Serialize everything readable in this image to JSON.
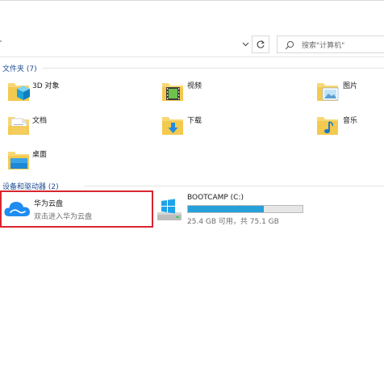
{
  "search": {
    "placeholder": "搜索\"计算机\""
  },
  "folders_section": {
    "title": "文件夹 (7)",
    "items": [
      {
        "name": "3D 对象",
        "icon": "3d-objects-folder-icon"
      },
      {
        "name": "视频",
        "icon": "videos-folder-icon"
      },
      {
        "name": "图片",
        "icon": "pictures-folder-icon"
      },
      {
        "name": "文档",
        "icon": "documents-folder-icon"
      },
      {
        "name": "下载",
        "icon": "downloads-folder-icon"
      },
      {
        "name": "音乐",
        "icon": "music-folder-icon"
      },
      {
        "name": "桌面",
        "icon": "desktop-folder-icon"
      }
    ]
  },
  "drives_section": {
    "title": "设备和驱动器 (2)",
    "drives": [
      {
        "name": "华为云盘",
        "subtitle": "双击进入华为云盘",
        "icon": "huawei-cloud-icon",
        "selected": true,
        "highlight_color": "#d8262f"
      },
      {
        "name": "BOOTCAMP (C:)",
        "subtitle": "25.4 GB 可用，共 75.1 GB",
        "icon": "windows-drive-icon",
        "used_fraction": 0.66
      }
    ]
  },
  "colors": {
    "section_header": "#1c4c93",
    "folder": "#f8d775",
    "usage_bar": "#26a0da",
    "cloud": "#1f8cf0"
  }
}
